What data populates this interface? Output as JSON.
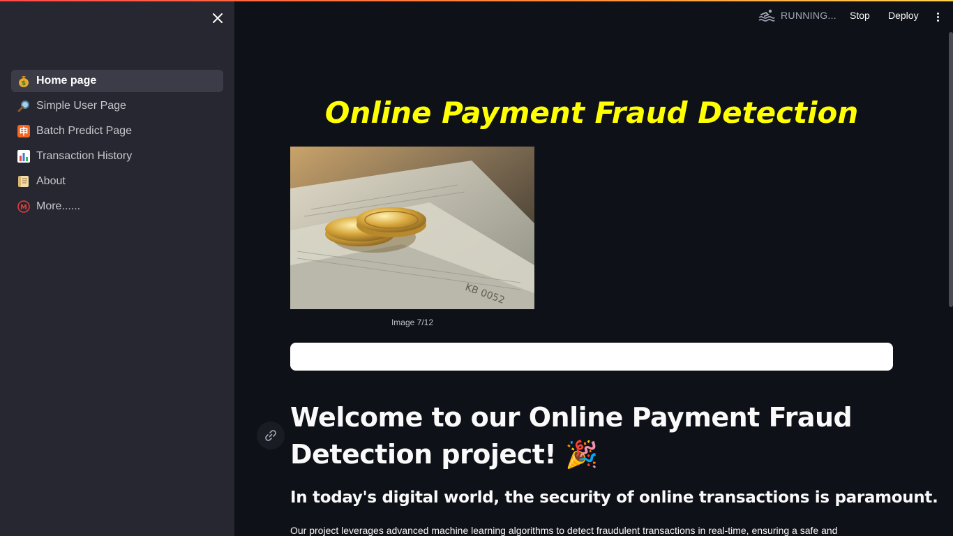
{
  "sidebar": {
    "close_icon": "close-icon",
    "items": [
      {
        "label": "Home page",
        "icon": "money-bag-icon",
        "active": true
      },
      {
        "label": "Simple User Page",
        "icon": "magnifier-icon",
        "active": false
      },
      {
        "label": "Batch Predict Page",
        "icon": "batch-icon",
        "active": false
      },
      {
        "label": "Transaction History",
        "icon": "bar-chart-icon",
        "active": false
      },
      {
        "label": "About",
        "icon": "scroll-icon",
        "active": false
      },
      {
        "label": "More......",
        "icon": "circled-m-icon",
        "active": false
      }
    ]
  },
  "header": {
    "status": "RUNNING...",
    "stop_label": "Stop",
    "deploy_label": "Deploy"
  },
  "main": {
    "title": "Online Payment Fraud Detection",
    "image_caption": "Image 7/12",
    "welcome_line1": "Welcome to our Online Payment Fraud",
    "welcome_line2": "Detection project! 🎉",
    "subheading": "In today's digital world, the security of online transactions is paramount.",
    "paragraph": "Our project leverages advanced machine learning algorithms to detect fraudulent transactions in real-time, ensuring a safe and"
  },
  "colors": {
    "background": "#0e1117",
    "sidebar": "#262730",
    "title": "#ffff00",
    "accent": "#ff4b4b"
  }
}
